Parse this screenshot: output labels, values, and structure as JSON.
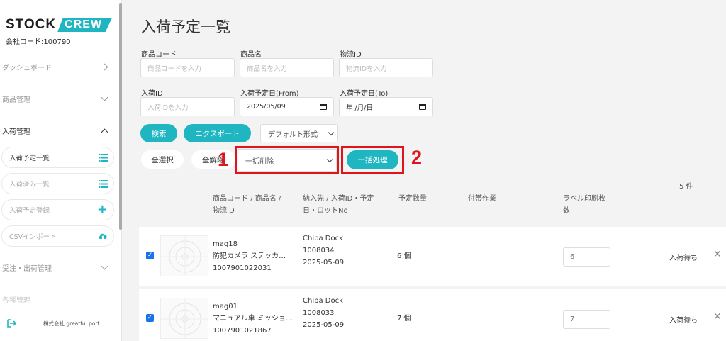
{
  "brand": {
    "stock": "STOCK",
    "crew": "CREW",
    "company_code": "会社コード:100790"
  },
  "sidebar": {
    "sections": [
      {
        "label": "ダッシュボード"
      },
      {
        "label": "商品管理"
      },
      {
        "label": "入荷管理"
      }
    ],
    "sub_items": [
      {
        "label": "入荷予定一覧"
      },
      {
        "label": "入荷済み一覧"
      },
      {
        "label": "入荷予定登録"
      },
      {
        "label": "CSVインポート"
      }
    ],
    "sections_after": [
      {
        "label": "受注・出荷管理"
      },
      {
        "label": "各種管理"
      }
    ],
    "footer_company": "株式会社 greatful port"
  },
  "page": {
    "title": "入荷予定一覧"
  },
  "filters": {
    "product_code": {
      "label": "商品コード",
      "placeholder": "商品コードを入力"
    },
    "product_name": {
      "label": "商品名",
      "placeholder": "商品名を入力"
    },
    "logistics_id": {
      "label": "物流ID",
      "placeholder": "物流IDを入力"
    },
    "arrival_id": {
      "label": "入荷ID",
      "placeholder": "入荷IDを入力"
    },
    "date_from": {
      "label": "入荷予定日(From)",
      "value": "2025/05/09"
    },
    "date_to": {
      "label": "入荷予定日(To)",
      "value": "年 /月/日"
    }
  },
  "actions": {
    "search": "検索",
    "export": "エクスポート",
    "format_select": "デフォルト形式",
    "select_all": "全選択",
    "deselect_all": "全解除",
    "bulk_select": "一括削除",
    "bulk_process": "一括処理"
  },
  "callouts": {
    "first": "1",
    "second": "2"
  },
  "list": {
    "count": "5 件",
    "headers": {
      "product": [
        "商品コード / 商品名 /",
        "物流ID"
      ],
      "destination": [
        "納入先 / 入荷ID・予定",
        "日・ロットNo"
      ],
      "qty": "予定数量",
      "work": "付帯作業",
      "label_count": [
        "ラベル印刷枚",
        "数"
      ]
    },
    "rows": [
      {
        "code": "mag18",
        "name": "防犯カメラ ステッカ…",
        "logistics_id": "1007901022031",
        "dest": "Chiba Dock",
        "arrival_id": "1008034",
        "date": "2025-05-09",
        "qty": "6 個",
        "label_count": "6",
        "status": "入荷待ち"
      },
      {
        "code": "mag01",
        "name": "マニュアル車 ミッショ…",
        "logistics_id": "1007901021867",
        "dest": "Chiba Dock",
        "arrival_id": "1008033",
        "date": "2025-05-09",
        "qty": "7 個",
        "label_count": "7",
        "status": "入荷待ち"
      }
    ]
  }
}
